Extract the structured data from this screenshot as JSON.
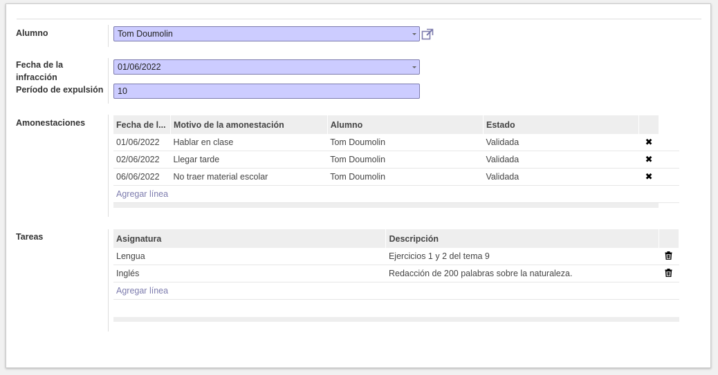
{
  "form": {
    "alumno_label": "Alumno",
    "alumno_value": "Tom Doumolin",
    "fecha_label_line1": "Fecha de la",
    "fecha_label_line2": "infracción",
    "fecha_value": "01/06/2022",
    "periodo_label": "Período de expulsión",
    "periodo_value": "10"
  },
  "amonestaciones": {
    "label": "Amonestaciones",
    "headers": [
      "Fecha de l...",
      "Motivo de la amonestación",
      "Alumno",
      "Estado"
    ],
    "rows": [
      {
        "fecha": "01/06/2022",
        "motivo": "Hablar en clase",
        "alumno": "Tom Doumolin",
        "estado": "Validada"
      },
      {
        "fecha": "02/06/2022",
        "motivo": "Llegar tarde",
        "alumno": "Tom Doumolin",
        "estado": "Validada"
      },
      {
        "fecha": "06/06/2022",
        "motivo": "No traer material escolar",
        "alumno": "Tom Doumolin",
        "estado": "Validada"
      }
    ],
    "add_line": "Agregar línea",
    "remove_glyph": "✖"
  },
  "tareas": {
    "label": "Tareas",
    "headers": [
      "Asignatura",
      "Descripción"
    ],
    "rows": [
      {
        "asignatura": "Lengua",
        "descripcion": "Ejercicios 1 y 2 del tema 9"
      },
      {
        "asignatura": "Inglés",
        "descripcion": "Redacción de 200 palabras sobre la naturaleza."
      }
    ],
    "add_line": "Agregar línea"
  },
  "colors": {
    "field_bg": "#ccccff",
    "field_border": "#7c7bad",
    "link": "#7c7bad"
  }
}
